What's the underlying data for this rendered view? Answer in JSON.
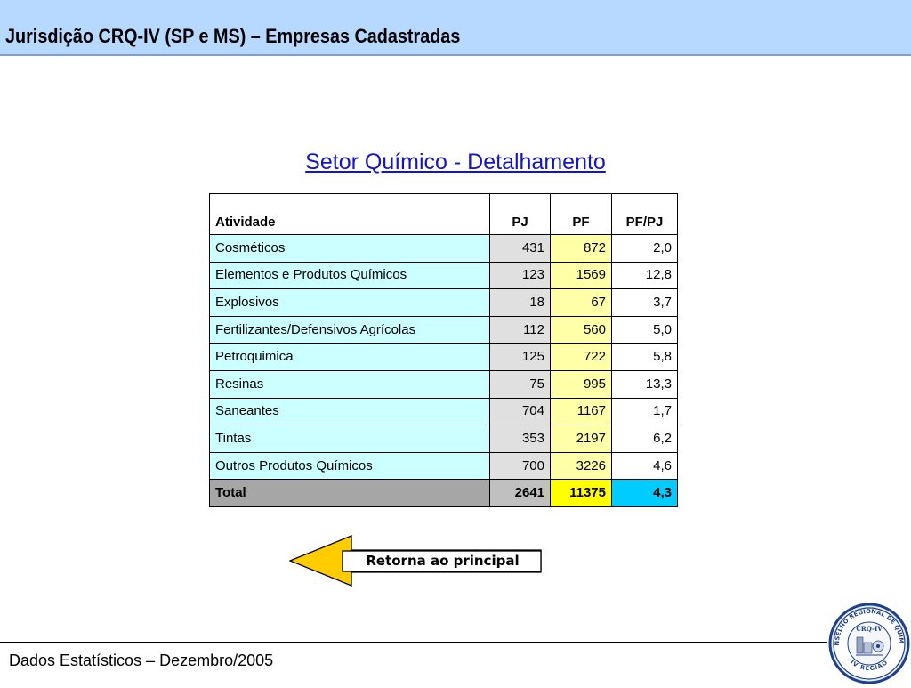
{
  "header": {
    "title": "Jurisdição CRQ-IV (SP e MS) – Empresas Cadastradas"
  },
  "subtitle": "Setor Químico - Detalhamento",
  "table": {
    "columns": [
      "Atividade",
      "PJ",
      "PF",
      "PF/PJ"
    ],
    "rows": [
      {
        "atividade": "Cosméticos",
        "pj": "431",
        "pf": "872",
        "ratio": "2,0"
      },
      {
        "atividade": "Elementos e Produtos Químicos",
        "pj": "123",
        "pf": "1569",
        "ratio": "12,8"
      },
      {
        "atividade": "Explosivos",
        "pj": "18",
        "pf": "67",
        "ratio": "3,7"
      },
      {
        "atividade": "Fertilizantes/Defensivos Agrícolas",
        "pj": "112",
        "pf": "560",
        "ratio": "5,0"
      },
      {
        "atividade": "Petroquimica",
        "pj": "125",
        "pf": "722",
        "ratio": "5,8"
      },
      {
        "atividade": "Resinas",
        "pj": "75",
        "pf": "995",
        "ratio": "13,3"
      },
      {
        "atividade": "Saneantes",
        "pj": "704",
        "pf": "1167",
        "ratio": "1,7"
      },
      {
        "atividade": "Tintas",
        "pj": "353",
        "pf": "2197",
        "ratio": "6,2"
      },
      {
        "atividade": "Outros Produtos Químicos",
        "pj": "700",
        "pf": "3226",
        "ratio": "4,6"
      }
    ],
    "total": {
      "atividade": "Total",
      "pj": "2641",
      "pf": "11375",
      "ratio": "4,3"
    }
  },
  "back_button": {
    "label": "Retorna ao principal",
    "icon": "arrow-left-icon"
  },
  "footer": {
    "text": "Dados Estatísticos – Dezembro/2005"
  },
  "logo": {
    "icon": "crq-iv-seal",
    "text_center": "CRQ-IV",
    "text_ring_top": "CONSELHO REGIONAL DE QUÍMICA",
    "text_ring_bottom": "IV REGIÃO"
  },
  "colors": {
    "header_bg": "#b7d9ff",
    "subtitle": "#1515c8",
    "activity_cell": "#ccffff",
    "pj_cell": "#e0e0e0",
    "pf_cell": "#ffffa8",
    "total_activity": "#a6a6a6",
    "total_pj": "#c0c0c0",
    "total_pf": "#ffff00",
    "total_ratio": "#00ccff",
    "arrow_fill": "#ffcc00"
  }
}
